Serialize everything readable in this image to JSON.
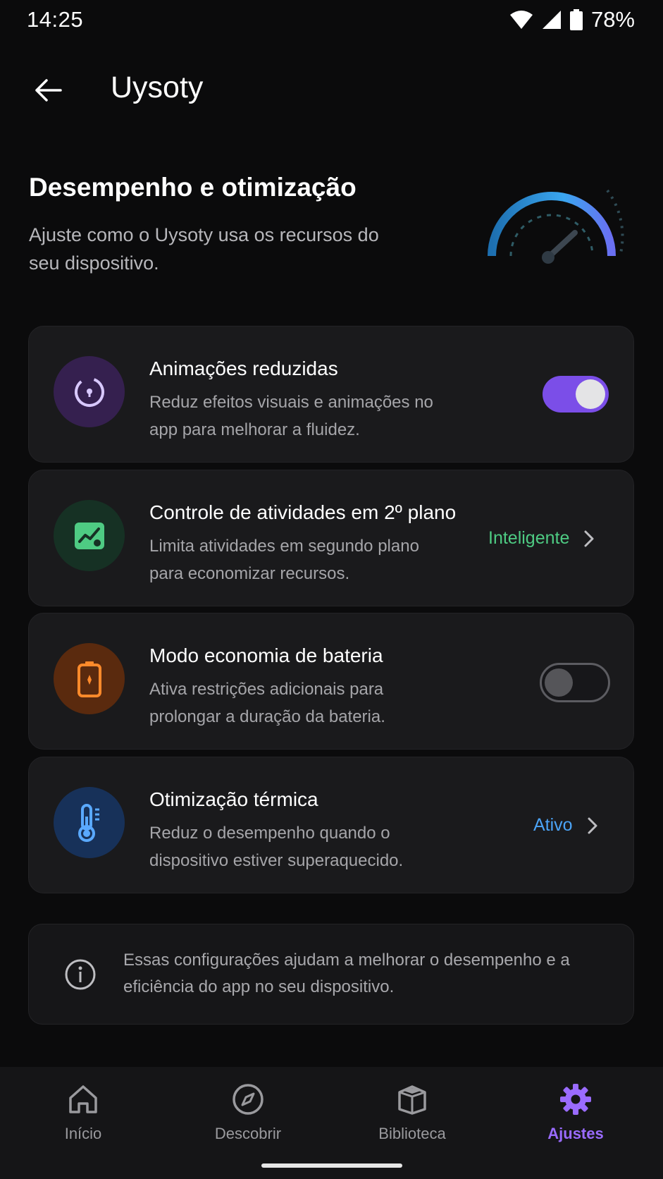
{
  "status_bar": {
    "time": "14:25",
    "battery_percent": "78%",
    "icons": [
      "wifi-icon",
      "signal-icon",
      "battery-icon"
    ]
  },
  "app_bar": {
    "title": "Uysoty",
    "back_icon": "back-arrow-icon"
  },
  "header": {
    "title": "Desempenho e otimização",
    "description": "Ajuste como o Uysoty usa os recursos do seu dispositivo.",
    "illustration_icon": "speedometer-icon"
  },
  "settings": [
    {
      "title": "Animações reduzidas",
      "description": "Reduz efeitos visuais e animações no app para melhorar a fluidez.",
      "icon": "reduced-motion-icon",
      "icon_bg": "#35204f",
      "icon_color": "#d8c8ff",
      "control": "toggle",
      "toggle_on": true
    },
    {
      "title": "Controle de atividades em 2º plano",
      "description": "Limita atividades em segundo plano para economizar recursos.",
      "icon": "background-activity-icon",
      "icon_bg": "#163124",
      "icon_color": "#4ecb83",
      "control": "link",
      "value": "Inteligente",
      "value_color": "#4ecb83"
    },
    {
      "title": "Modo economia de bateria",
      "description": "Ativa restrições adicionais para prolongar a duração da bateria.",
      "icon": "battery-saver-icon",
      "icon_bg": "#5a2a0e",
      "icon_color": "#ff8a2b",
      "control": "toggle",
      "toggle_on": false
    },
    {
      "title": "Otimização térmica",
      "description": "Reduz o desempenho quando o dispositivo estiver superaquecido.",
      "icon": "thermometer-icon",
      "icon_bg": "#173159",
      "icon_color": "#5aa9ff",
      "control": "link",
      "value": "Ativo",
      "value_color": "#4ba3f5"
    }
  ],
  "info": {
    "text": "Essas configurações ajudam a melhorar o desempenho e a eficiência do app no seu dispositivo.",
    "icon": "info-icon"
  },
  "bottom_nav": {
    "items": [
      {
        "label": "Início",
        "icon": "home-icon",
        "active": false
      },
      {
        "label": "Descobrir",
        "icon": "compass-icon",
        "active": false
      },
      {
        "label": "Biblioteca",
        "icon": "library-icon",
        "active": false
      },
      {
        "label": "Ajustes",
        "icon": "gear-icon",
        "active": true
      }
    ],
    "active_color": "#9a6bff"
  }
}
